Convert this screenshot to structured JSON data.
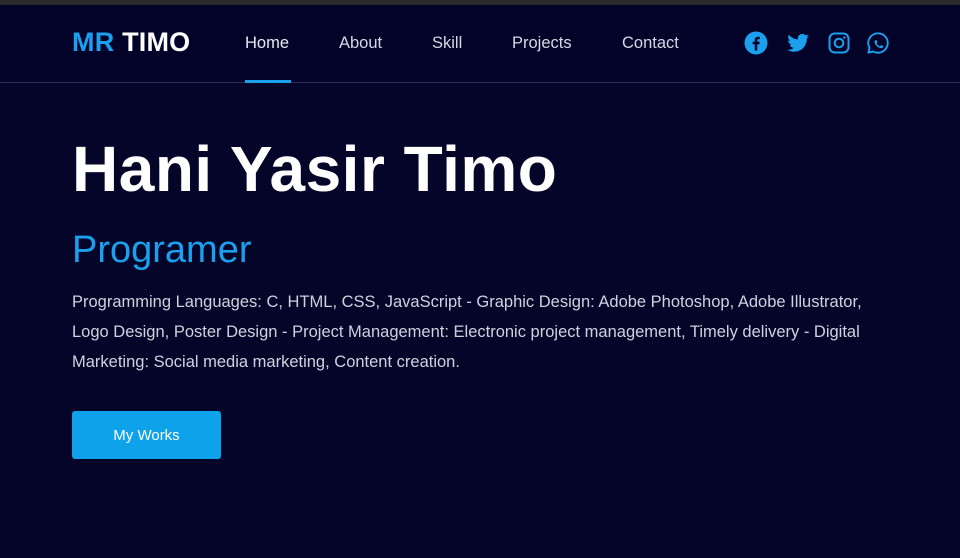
{
  "brand": {
    "part1": "MR",
    "part2": "TIMO",
    "accent_color": "#1aa0ec"
  },
  "nav": {
    "items": [
      {
        "label": "Home",
        "active": true
      },
      {
        "label": "About",
        "active": false
      },
      {
        "label": "Skill",
        "active": false
      },
      {
        "label": "Projects",
        "active": false
      },
      {
        "label": "Contact",
        "active": false
      }
    ]
  },
  "social": [
    {
      "icon": "facebook-icon"
    },
    {
      "icon": "twitter-icon"
    },
    {
      "icon": "instagram-icon"
    },
    {
      "icon": "whatsapp-icon"
    }
  ],
  "hero": {
    "title": "Hani Yasir Timo",
    "subtitle": "Programer",
    "description": "Programming Languages: C, HTML, CSS, JavaScript - Graphic Design: Adobe Photoshop, Adobe Illustrator, Logo Design, Poster Design - Project Management: Electronic project management, Timely delivery - Digital Marketing: Social media marketing, Content creation.",
    "button_label": "My Works"
  },
  "colors": {
    "background": "#05052a",
    "navbar": "#03032a",
    "accent": "#1aa0ec",
    "button": "#0ea2ea"
  }
}
